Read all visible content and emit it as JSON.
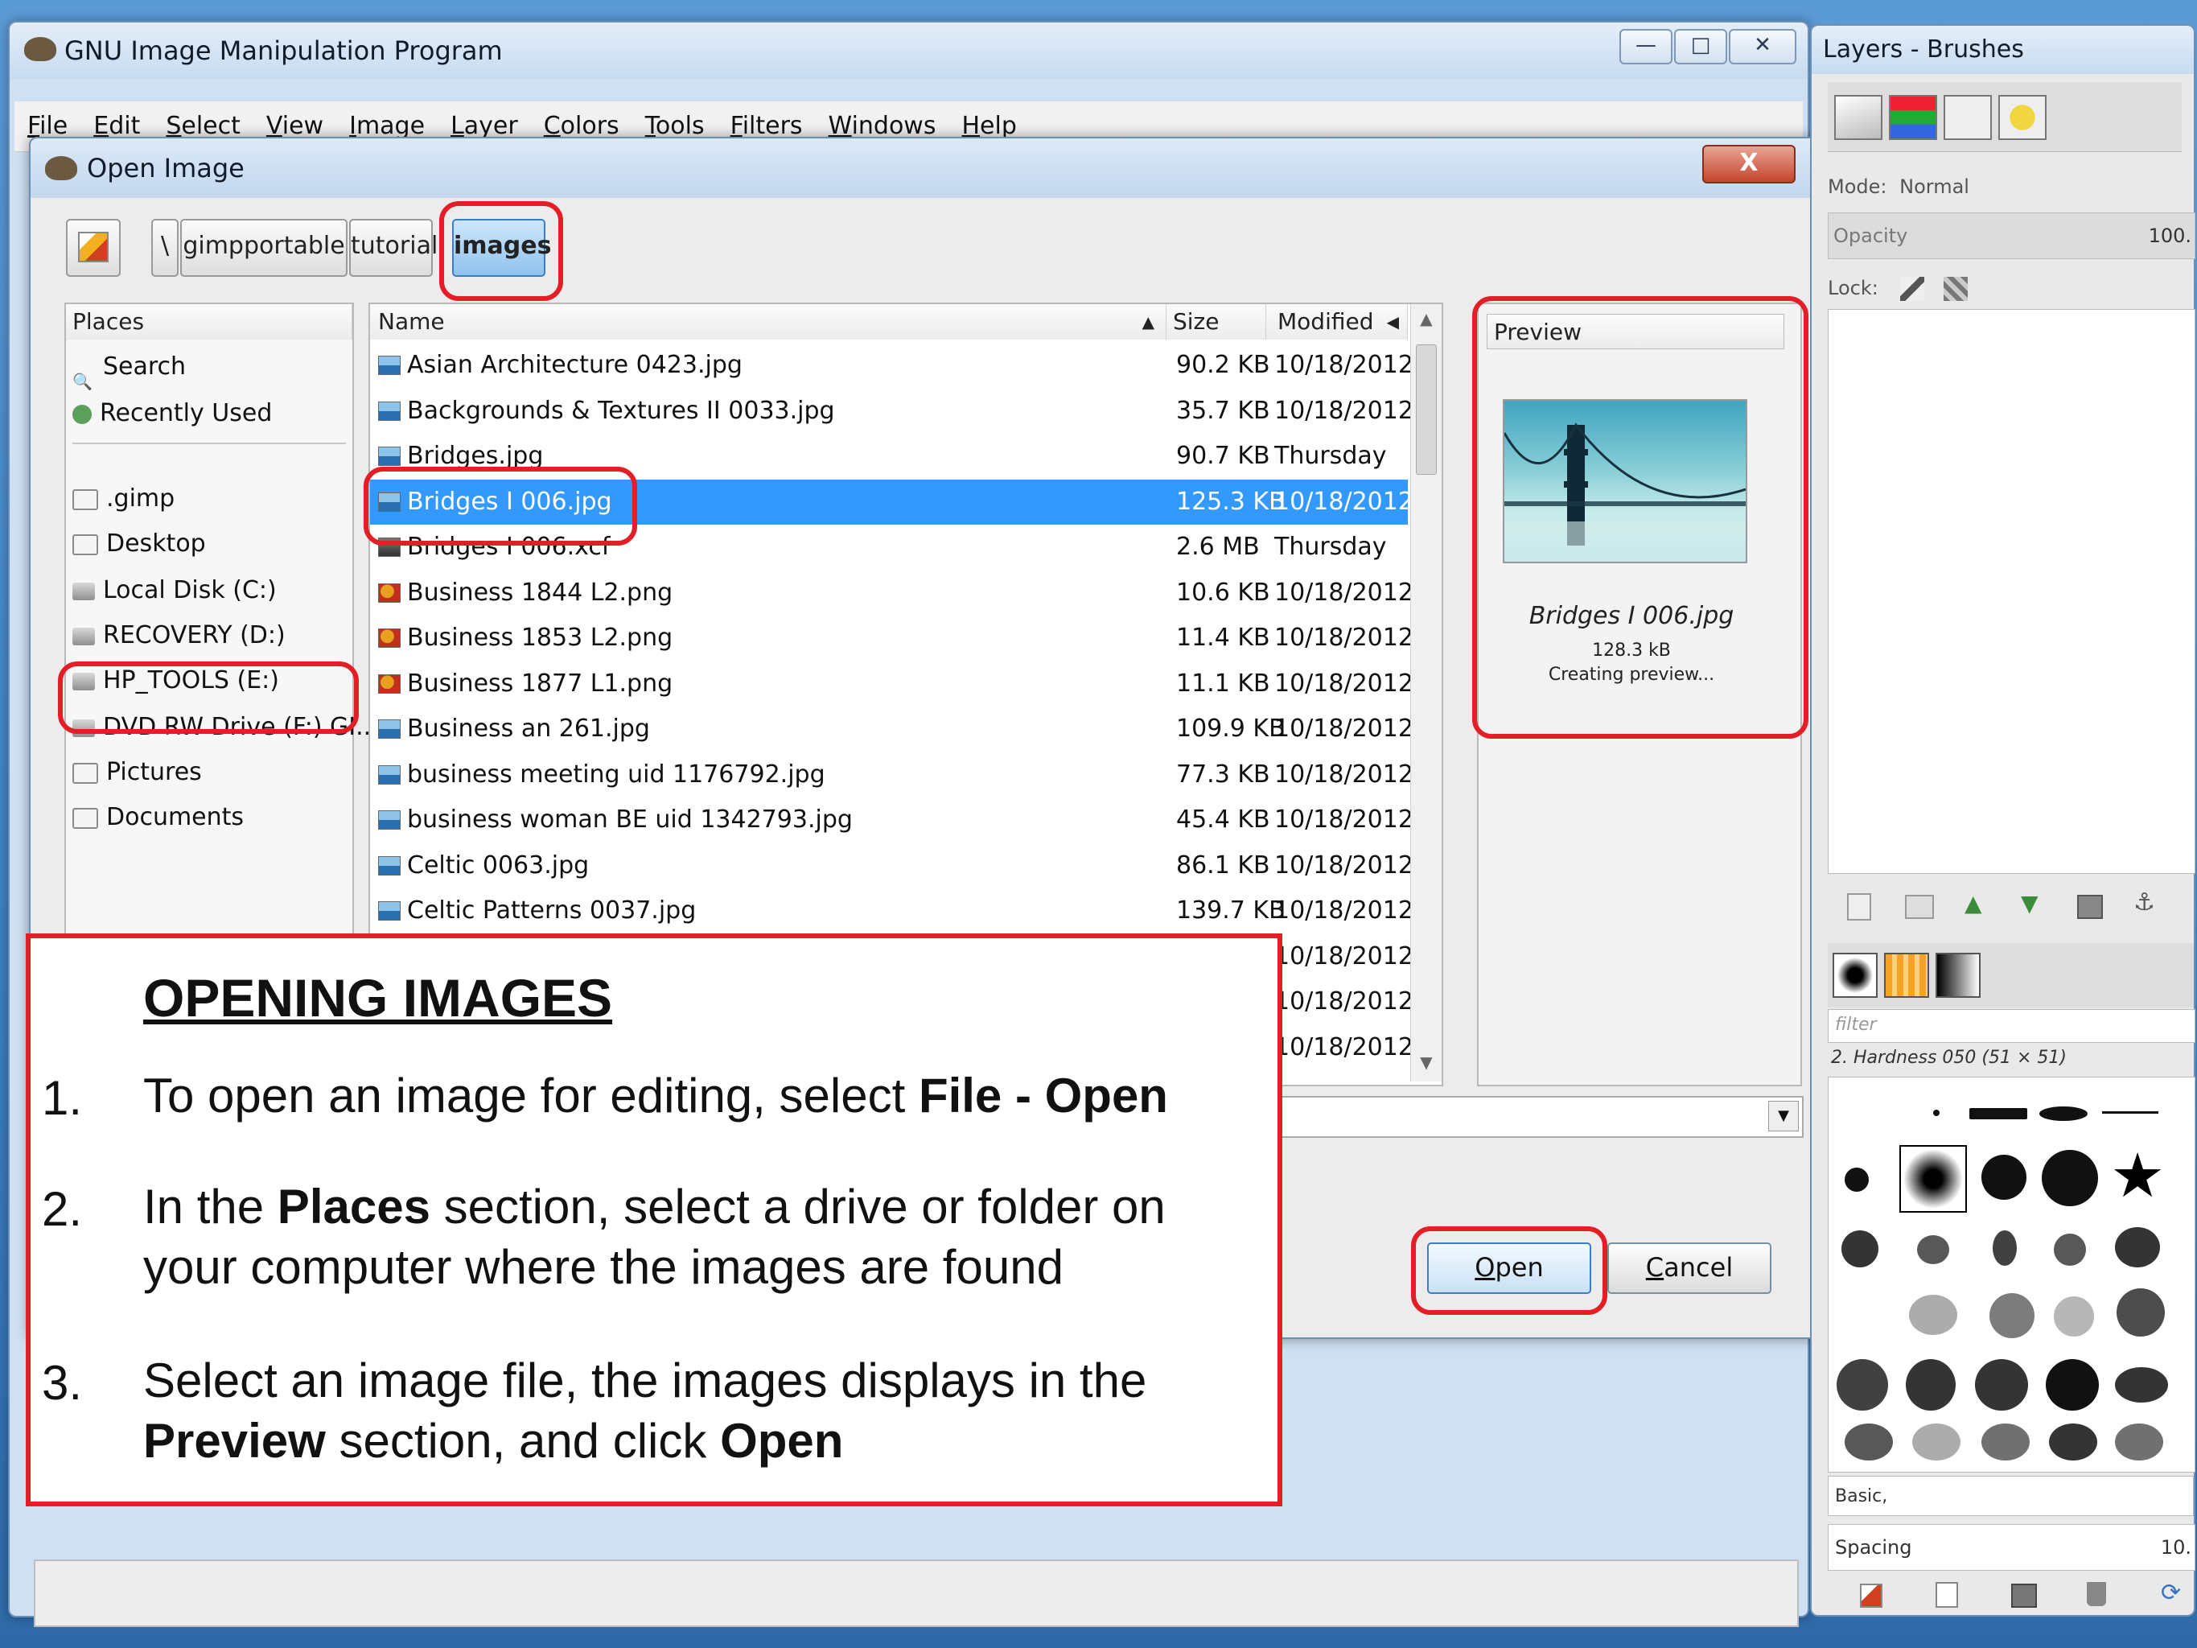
{
  "main_window": {
    "title": "GNU Image Manipulation Program",
    "caption_buttons": {
      "minimize": "—",
      "maximize": "□",
      "close": "✕"
    },
    "menu": [
      "File",
      "Edit",
      "Select",
      "View",
      "Image",
      "Layer",
      "Colors",
      "Tools",
      "Filters",
      "Windows",
      "Help"
    ]
  },
  "dialog": {
    "title": "Open Image",
    "close_label": "X",
    "path_buttons": [
      "\\",
      "gimpportable",
      "tutorial",
      "images"
    ],
    "places_header": "Places",
    "places": [
      {
        "label": "Search",
        "icon": "search-icon"
      },
      {
        "label": "Recently Used",
        "icon": "recent-icon"
      },
      {
        "label": ".gimp",
        "icon": "folder-icon"
      },
      {
        "label": "Desktop",
        "icon": "folder-icon"
      },
      {
        "label": "Local Disk (C:)",
        "icon": "drive-icon"
      },
      {
        "label": "RECOVERY (D:)",
        "icon": "drive-icon"
      },
      {
        "label": "HP_TOOLS (E:)",
        "icon": "drive-icon"
      },
      {
        "label": "DVD RW Drive (F:) GI...",
        "icon": "dvd-icon"
      },
      {
        "label": "Pictures",
        "icon": "folder-icon"
      },
      {
        "label": "Documents",
        "icon": "folder-icon"
      }
    ],
    "columns": {
      "name": "Name",
      "size": "Size",
      "modified": "Modified"
    },
    "files": [
      {
        "name": "Asian Architecture 0423.jpg",
        "size": "90.2 KB",
        "modified": "10/18/2012",
        "type": "jpg"
      },
      {
        "name": "Backgrounds & Textures II 0033.jpg",
        "size": "35.7 KB",
        "modified": "10/18/2012",
        "type": "jpg"
      },
      {
        "name": "Bridges.jpg",
        "size": "90.7 KB",
        "modified": "Thursday",
        "type": "jpg"
      },
      {
        "name": "Bridges I 006.jpg",
        "size": "125.3 KB",
        "modified": "10/18/2012",
        "type": "jpg",
        "selected": true
      },
      {
        "name": "Bridges I 006.xcf",
        "size": "2.6 MB",
        "modified": "Thursday",
        "type": "xcf"
      },
      {
        "name": "Business 1844 L2.png",
        "size": "10.6 KB",
        "modified": "10/18/2012",
        "type": "png"
      },
      {
        "name": "Business 1853 L2.png",
        "size": "11.4 KB",
        "modified": "10/18/2012",
        "type": "png"
      },
      {
        "name": "Business 1877 L1.png",
        "size": "11.1 KB",
        "modified": "10/18/2012",
        "type": "png"
      },
      {
        "name": "Business an 261.jpg",
        "size": "109.9 KB",
        "modified": "10/18/2012",
        "type": "jpg"
      },
      {
        "name": "business meeting uid 1176792.jpg",
        "size": "77.3 KB",
        "modified": "10/18/2012",
        "type": "jpg"
      },
      {
        "name": "business woman BE uid 1342793.jpg",
        "size": "45.4 KB",
        "modified": "10/18/2012",
        "type": "jpg"
      },
      {
        "name": "Celtic 0063.jpg",
        "size": "86.1 KB",
        "modified": "10/18/2012",
        "type": "jpg"
      },
      {
        "name": "Celtic Patterns 0037.jpg",
        "size": "139.7 KB",
        "modified": "10/18/2012",
        "type": "jpg"
      },
      {
        "name": "",
        "size": "",
        "modified": "10/18/2012",
        "type": ""
      },
      {
        "name": "",
        "size": "",
        "modified": "10/18/2012",
        "type": ""
      },
      {
        "name": "",
        "size": "",
        "modified": "10/18/2012",
        "type": ""
      }
    ],
    "preview": {
      "header": "Preview",
      "filename": "Bridges I 006.jpg",
      "size": "128.3 kB",
      "status": "Creating preview..."
    },
    "buttons": {
      "open_first": "O",
      "open_rest": "pen",
      "cancel_first": "C",
      "cancel_rest": "ancel"
    }
  },
  "dock": {
    "title": "Layers - Brushes",
    "mode_label": "Mode:",
    "mode_value": "Normal",
    "opacity_label": "Opacity",
    "opacity_value": "100.",
    "lock_label": "Lock:",
    "filter_placeholder": "filter",
    "brush_name": "2. Hardness 050 (51 × 51)",
    "brush_tag": "Basic,",
    "spacing_label": "Spacing",
    "spacing_value": "10."
  },
  "callout": {
    "title": "OPENING IMAGES",
    "steps": [
      {
        "num": "1.",
        "parts": [
          {
            "t": "To open an image for editing, select ",
            "b": false
          },
          {
            "t": "File - Open",
            "b": true
          }
        ]
      },
      {
        "num": "2.",
        "parts": [
          {
            "t": "In the ",
            "b": false
          },
          {
            "t": "Places",
            "b": true
          },
          {
            "t": " section, select a drive or folder on your computer where the images are found",
            "b": false
          }
        ]
      },
      {
        "num": "3.",
        "parts": [
          {
            "t": "Select an image file, the images displays in the ",
            "b": false
          },
          {
            "t": "Preview",
            "b": true
          },
          {
            "t": " section, and click ",
            "b": false
          },
          {
            "t": "Open",
            "b": true
          }
        ]
      }
    ]
  }
}
